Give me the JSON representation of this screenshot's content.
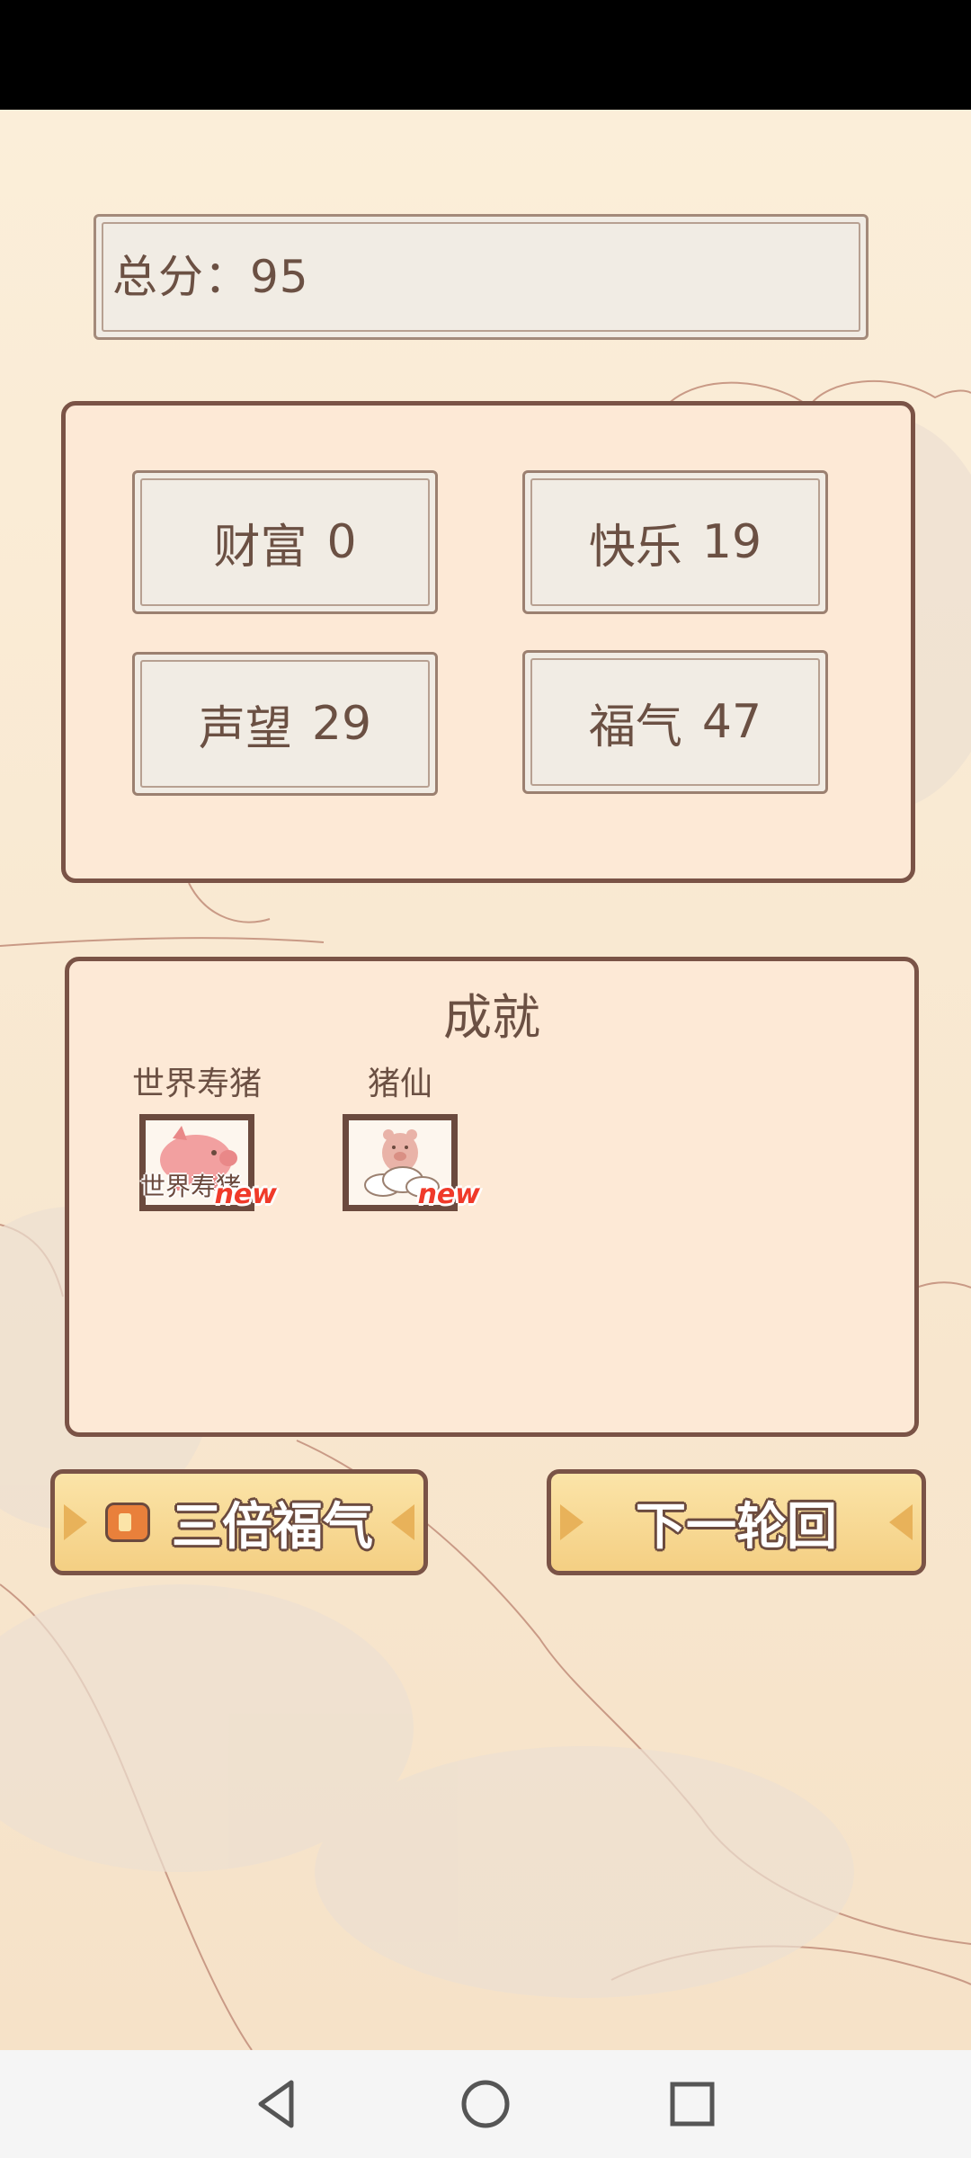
{
  "score": {
    "text": "总分：95"
  },
  "stats": [
    {
      "label": "财富",
      "value": "0"
    },
    {
      "label": "快乐",
      "value": "19"
    },
    {
      "label": "声望",
      "value": "29"
    },
    {
      "label": "福气",
      "value": "47"
    }
  ],
  "achievements": {
    "title": "成就",
    "items": [
      {
        "label": "世界寿猪",
        "icon_text": "世界寿猪",
        "badge": "new",
        "icon": "pink-pig-icon"
      },
      {
        "label": "猪仙",
        "badge": "new",
        "icon": "pig-on-cloud-icon"
      }
    ]
  },
  "actions": {
    "triple_label": "三倍福气",
    "next_label": "下一轮回"
  },
  "nav": {
    "icons": [
      "back-icon",
      "home-icon",
      "recents-icon"
    ]
  },
  "colors": {
    "brown": "#7a5346",
    "text": "#6b5043",
    "panel_bg": "#fde9d6",
    "button_yellow": "#f4cf83",
    "new_red": "#f03a2a"
  }
}
